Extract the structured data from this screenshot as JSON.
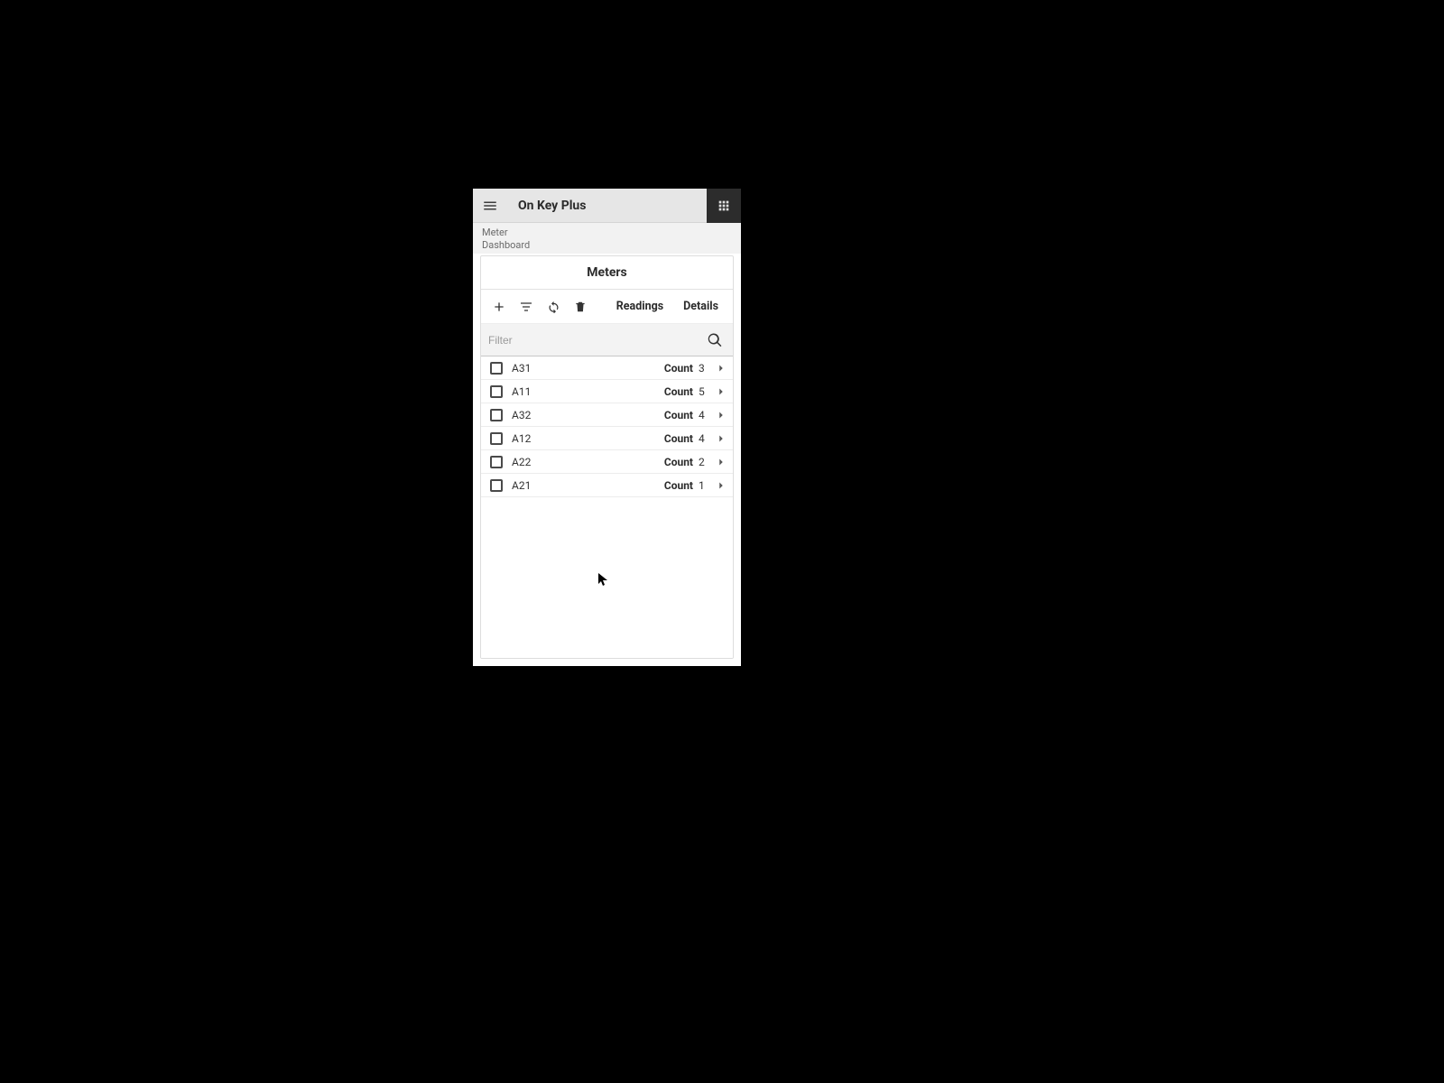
{
  "header": {
    "title": "On Key Plus"
  },
  "breadcrumb": {
    "line1": "Meter",
    "line2": "Dashboard"
  },
  "card": {
    "title": "Meters"
  },
  "tabs": {
    "readings": "Readings",
    "details": "Details"
  },
  "filter": {
    "placeholder": "Filter",
    "value": ""
  },
  "count_label": "Count",
  "meters": [
    {
      "name": "A31",
      "count": 3
    },
    {
      "name": "A11",
      "count": 5
    },
    {
      "name": "A32",
      "count": 4
    },
    {
      "name": "A12",
      "count": 4
    },
    {
      "name": "A22",
      "count": 2
    },
    {
      "name": "A21",
      "count": 1
    }
  ]
}
